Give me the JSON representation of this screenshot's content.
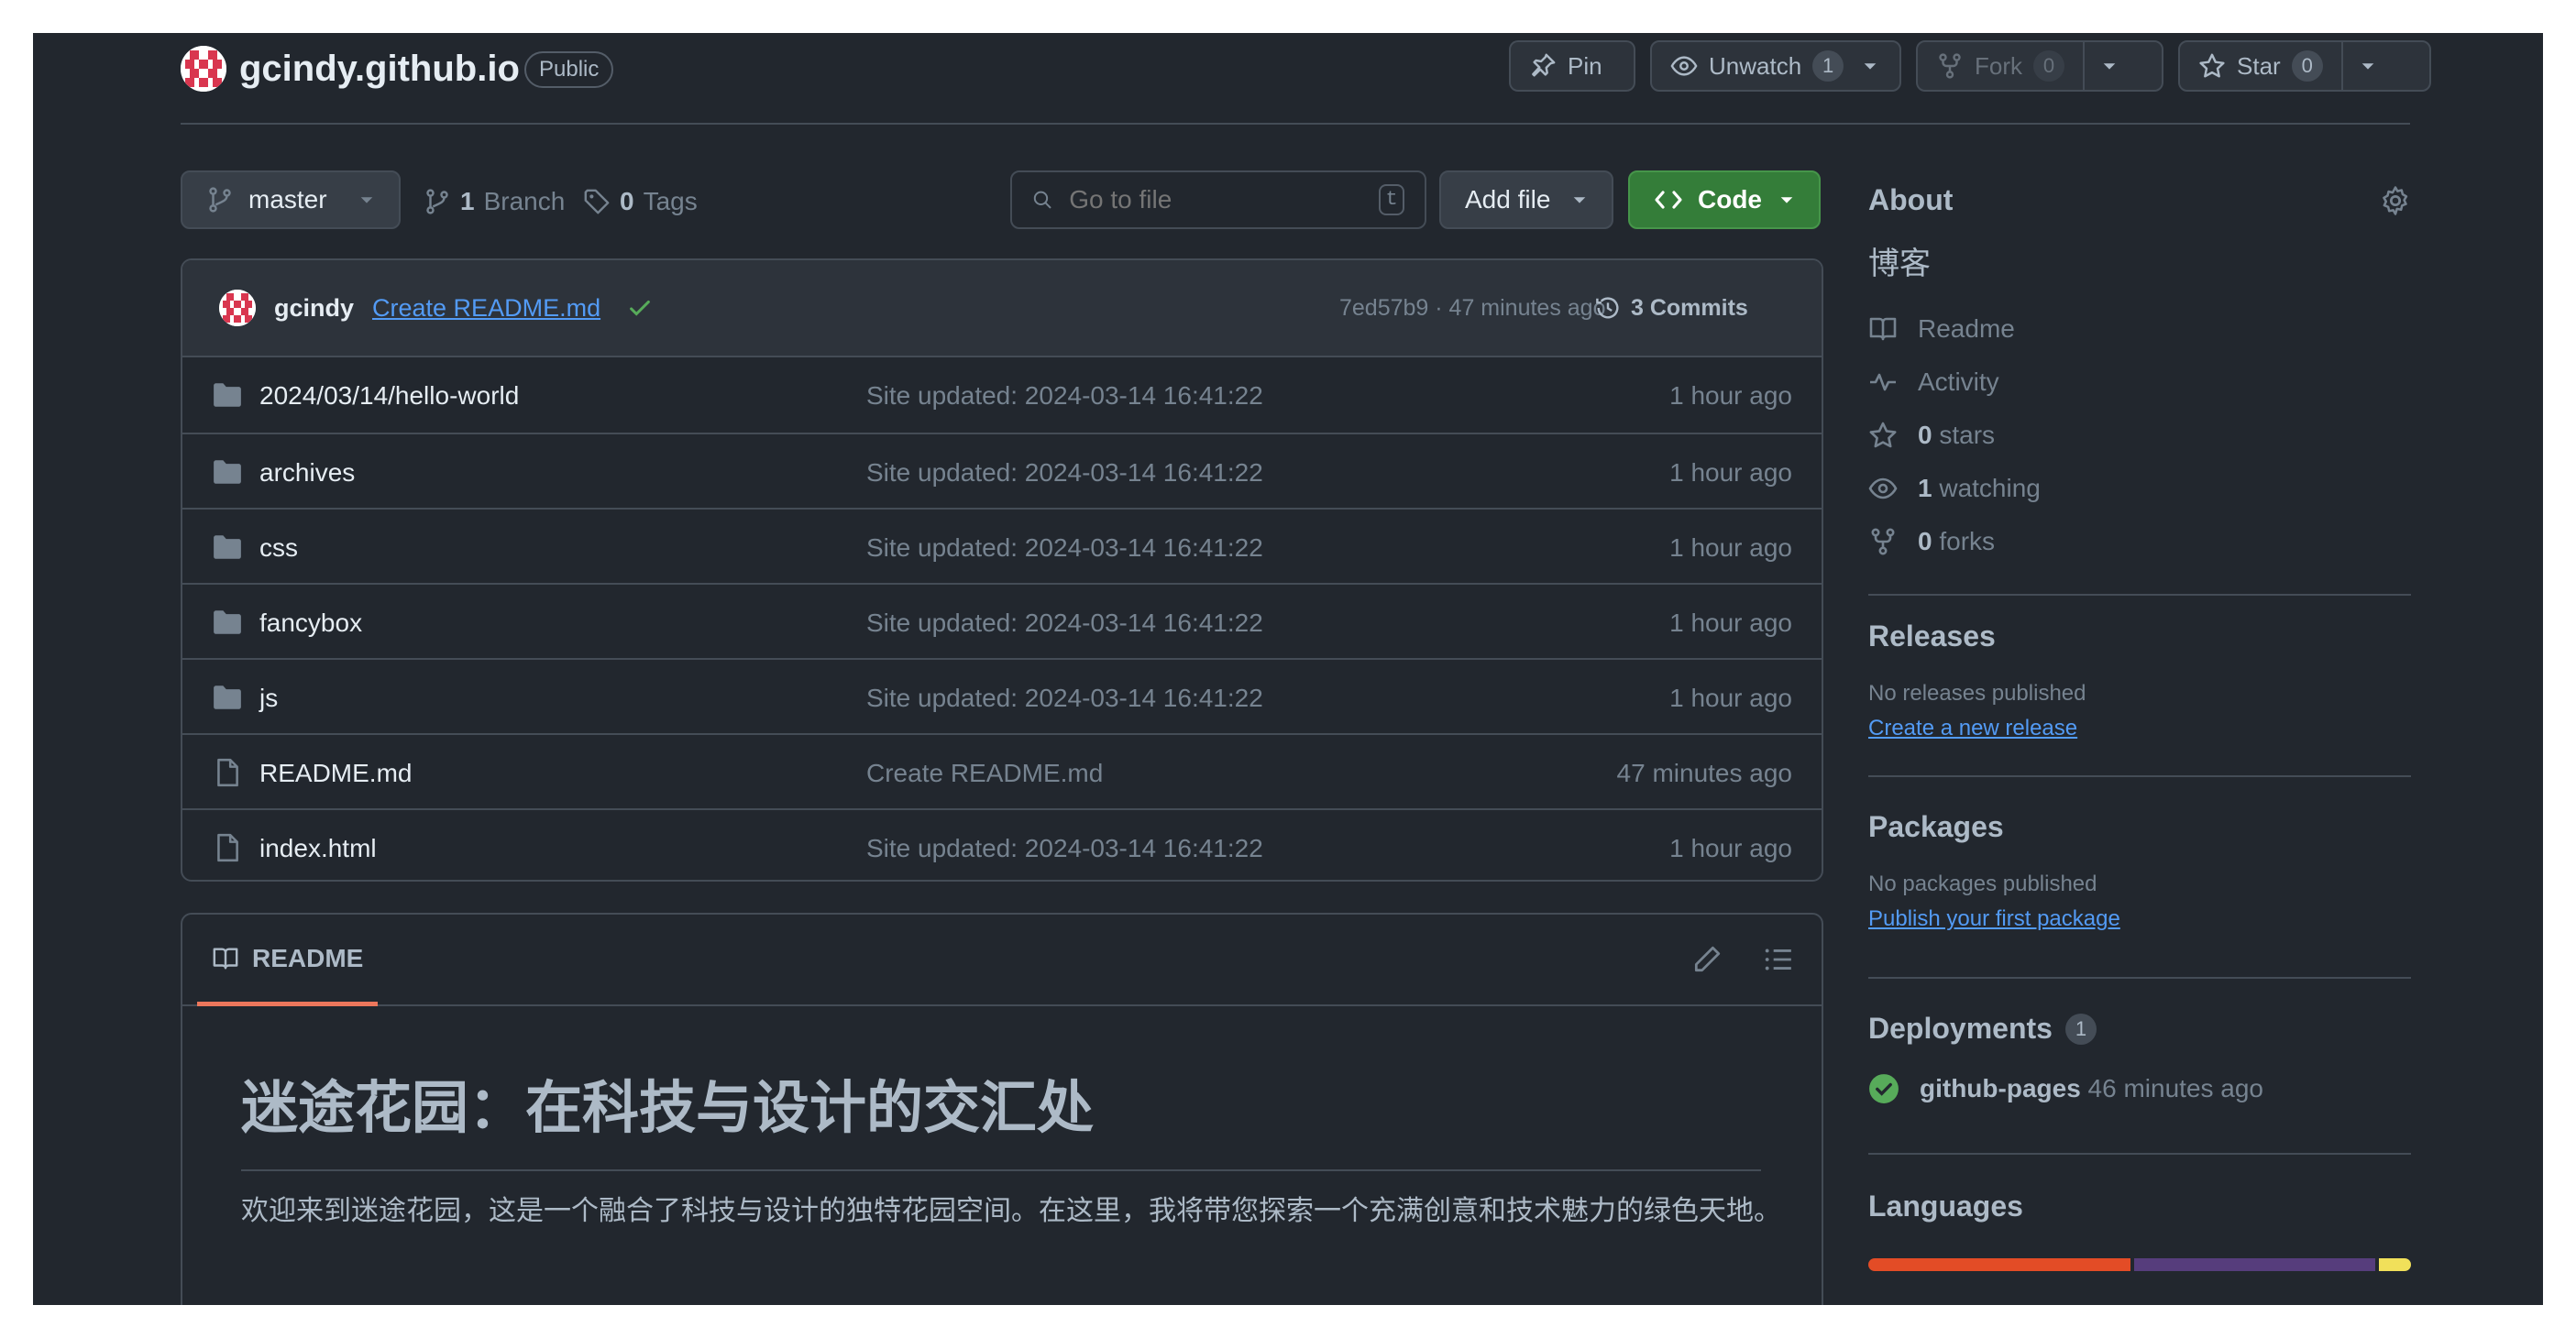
{
  "repo": {
    "name": "gcindy.github.io",
    "visibility": "Public"
  },
  "header_actions": {
    "pin": "Pin",
    "unwatch": "Unwatch",
    "watch_count": "1",
    "fork": "Fork",
    "fork_count": "0",
    "star": "Star",
    "star_count": "0"
  },
  "toolbar": {
    "branch": "master",
    "branch_count": "1",
    "branch_label": "Branch",
    "tag_count": "0",
    "tag_label": "Tags",
    "search_placeholder": "Go to file",
    "search_shortcut": "t",
    "add_file": "Add file",
    "code": "Code"
  },
  "last_commit": {
    "user": "gcindy",
    "message": "Create README.md",
    "meta": "7ed57b9 · 47 minutes ago",
    "commits": "3 Commits"
  },
  "files": [
    {
      "type": "dir",
      "name": "2024/03/14/hello-world",
      "message": "Site updated: 2024-03-14 16:41:22",
      "age": "1 hour ago"
    },
    {
      "type": "dir",
      "name": "archives",
      "message": "Site updated: 2024-03-14 16:41:22",
      "age": "1 hour ago"
    },
    {
      "type": "dir",
      "name": "css",
      "message": "Site updated: 2024-03-14 16:41:22",
      "age": "1 hour ago"
    },
    {
      "type": "dir",
      "name": "fancybox",
      "message": "Site updated: 2024-03-14 16:41:22",
      "age": "1 hour ago"
    },
    {
      "type": "dir",
      "name": "js",
      "message": "Site updated: 2024-03-14 16:41:22",
      "age": "1 hour ago"
    },
    {
      "type": "file",
      "name": "README.md",
      "message": "Create README.md",
      "age": "47 minutes ago"
    },
    {
      "type": "file",
      "name": "index.html",
      "message": "Site updated: 2024-03-14 16:41:22",
      "age": "1 hour ago"
    }
  ],
  "readme": {
    "tab": "README",
    "heading": "迷途花园：在科技与设计的交汇处",
    "paragraph": "欢迎来到迷途花园，这是一个融合了科技与设计的独特花园空间。在这里，我将带您探索一个充满创意和技术魅力的绿色天地。"
  },
  "about": {
    "title": "About",
    "description": "博客",
    "readme": "Readme",
    "activity": "Activity",
    "stars_count": "0",
    "stars_label": "stars",
    "watching_count": "1",
    "watching_label": "watching",
    "forks_count": "0",
    "forks_label": "forks"
  },
  "releases": {
    "title": "Releases",
    "empty": "No releases published",
    "link": "Create a new release"
  },
  "packages": {
    "title": "Packages",
    "empty": "No packages published",
    "link": "Publish your first package"
  },
  "deployments": {
    "title": "Deployments",
    "count": "1",
    "env": "github-pages",
    "age": "46 minutes ago"
  },
  "languages": {
    "title": "Languages",
    "bar": [
      {
        "share": 49,
        "color": "#e34c26"
      },
      {
        "share": 45,
        "color": "#563d7c"
      },
      {
        "share": 6,
        "color": "#f1e05a"
      }
    ]
  },
  "colors": {
    "bg": "#22272e",
    "border": "#444c56",
    "accent_green": "#347d39",
    "link": "#539bf5",
    "tab_underline": "#ec775c"
  }
}
